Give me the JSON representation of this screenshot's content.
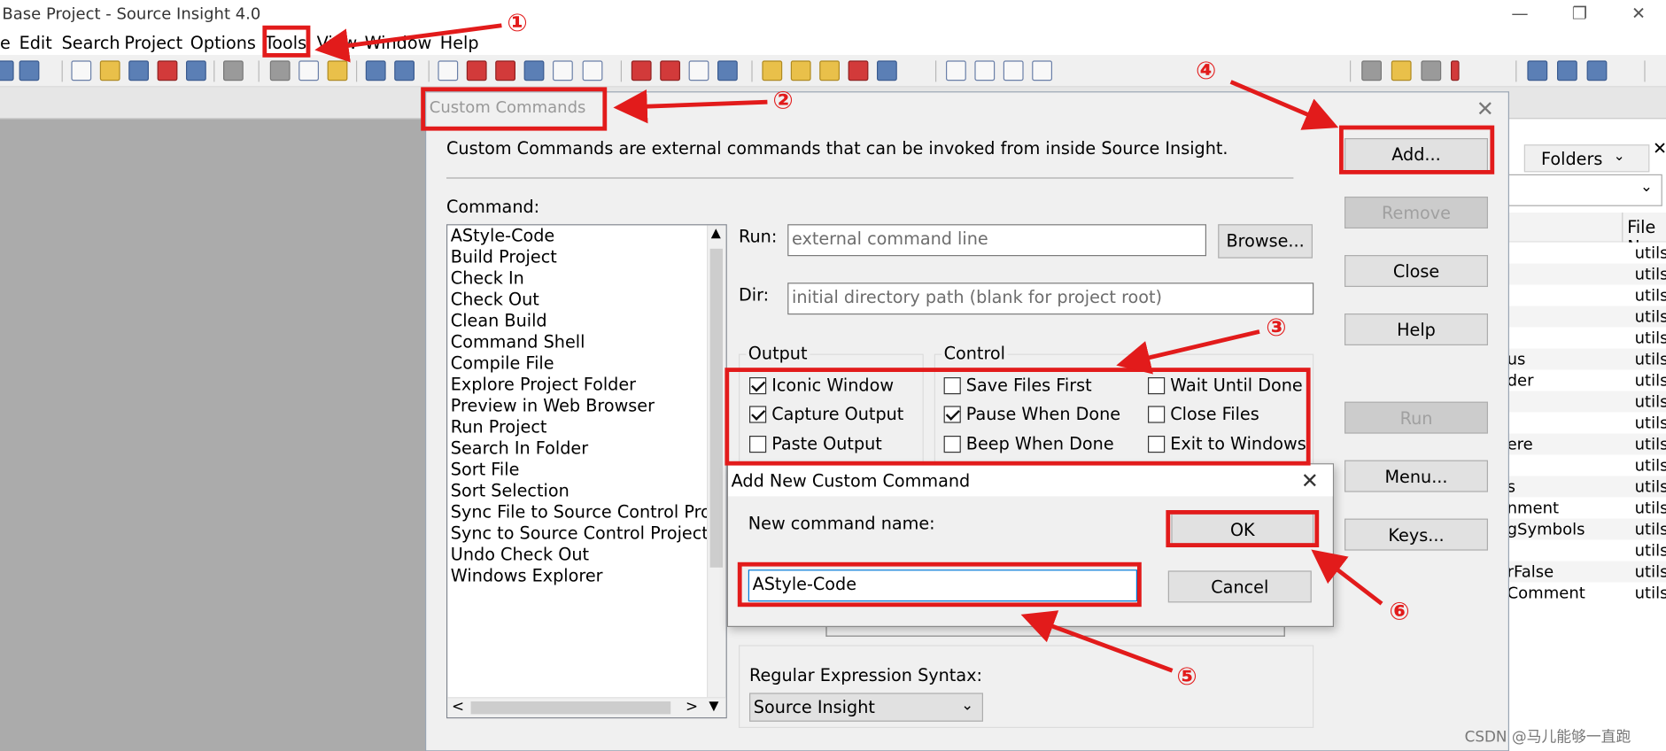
{
  "window": {
    "title": "Base Project - Source Insight 4.0"
  },
  "menu": [
    "e",
    "Edit",
    "Search",
    "Project",
    "Options",
    "Tools",
    "View",
    "Window",
    "Help"
  ],
  "custom_commands": {
    "title": "Custom Commands",
    "description": "Custom Commands are external commands that can be invoked from inside Source Insight.",
    "command_label": "Command:",
    "commands": [
      "AStyle-Code",
      "Build Project",
      "Check In",
      "Check Out",
      "Clean Build",
      "Command Shell",
      "Compile File",
      "Explore Project Folder",
      "Preview in Web Browser",
      "Run Project",
      "Search In Folder",
      "Sort File",
      "Sort Selection",
      "Sync File to Source Control Project",
      "Sync to Source Control Project",
      "Undo Check Out",
      "Windows Explorer"
    ],
    "run_label": "Run:",
    "run_placeholder": "external command line",
    "browse": "Browse...",
    "dir_label": "Dir:",
    "dir_placeholder": "initial directory path (blank for project root)",
    "output_label": "Output",
    "control_label": "Control",
    "output_options": [
      {
        "label": "Iconic Window",
        "checked": true
      },
      {
        "label": "Capture Output",
        "checked": true
      },
      {
        "label": "Paste Output",
        "checked": false
      }
    ],
    "control_options": [
      {
        "label": "Save Files First",
        "checked": false
      },
      {
        "label": "Wait Until Done",
        "checked": false
      },
      {
        "label": "Pause When Done",
        "checked": true
      },
      {
        "label": "Close Files",
        "checked": false
      },
      {
        "label": "Beep When Done",
        "checked": false
      },
      {
        "label": "Exit to Windows",
        "checked": false
      }
    ],
    "buttons": {
      "add": "Add...",
      "remove": "Remove",
      "close": "Close",
      "help": "Help",
      "run": "Run",
      "menu": "Menu...",
      "keys": "Keys..."
    },
    "regex_label": "Regular Expression Syntax:",
    "regex_value": "Source Insight"
  },
  "add_dialog": {
    "title": "Add New Custom Command",
    "name_label": "New command name:",
    "name_value": "AStyle-Code",
    "ok": "OK",
    "cancel": "Cancel"
  },
  "right_panel": {
    "tab": "Folders",
    "column": "File N",
    "rows": [
      {
        "name": "",
        "file": "utils"
      },
      {
        "name": "",
        "file": "utils"
      },
      {
        "name": "",
        "file": "utils"
      },
      {
        "name": "",
        "file": "utils"
      },
      {
        "name": "",
        "file": "utils"
      },
      {
        "name": "us",
        "file": "utils"
      },
      {
        "name": "der",
        "file": "utils"
      },
      {
        "name": "",
        "file": "utils"
      },
      {
        "name": "",
        "file": "utils"
      },
      {
        "name": "ere",
        "file": "utils"
      },
      {
        "name": "",
        "file": "utils"
      },
      {
        "name": "s",
        "file": "utils"
      },
      {
        "name": "nment",
        "file": "utils"
      },
      {
        "name": "gSymbols",
        "file": "utils"
      },
      {
        "name": "",
        "file": "utils"
      },
      {
        "name": "rFalse",
        "file": "utils"
      },
      {
        "name": "Comment",
        "file": "utils"
      }
    ]
  },
  "callouts": [
    "①",
    "②",
    "③",
    "④",
    "⑤",
    "⑥"
  ],
  "watermark": "CSDN @马儿能够一直跑",
  "colors": {
    "annotation": "#e21b1b",
    "toolbar_icon": "#5b7fb5"
  }
}
